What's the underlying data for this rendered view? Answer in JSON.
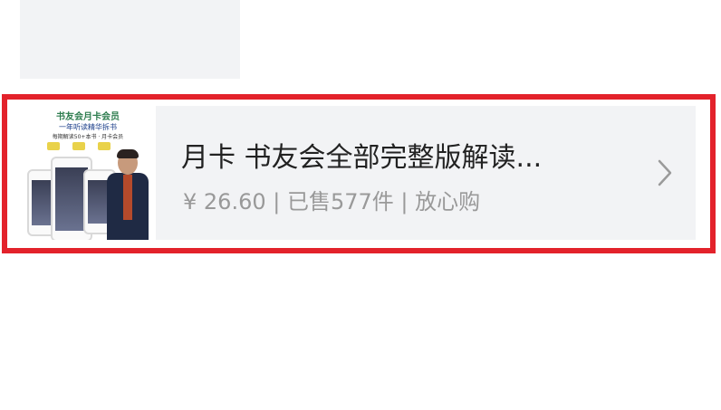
{
  "product": {
    "title": "月卡 书友会全部完整版解读...",
    "meta": "¥ 26.60 | 已售577件 | 放心购",
    "thumbnail": {
      "title_line": "书友会月卡会员",
      "subtitle_line": "一年听读精华拆书",
      "tagline": "每期解读50+本书 · 月卡会员"
    }
  },
  "icons": {
    "chevron": "chevron-right-icon"
  },
  "colors": {
    "highlight": "#e3222b",
    "card_bg": "#f2f3f5",
    "title_text": "#222222",
    "meta_text": "#999999"
  }
}
